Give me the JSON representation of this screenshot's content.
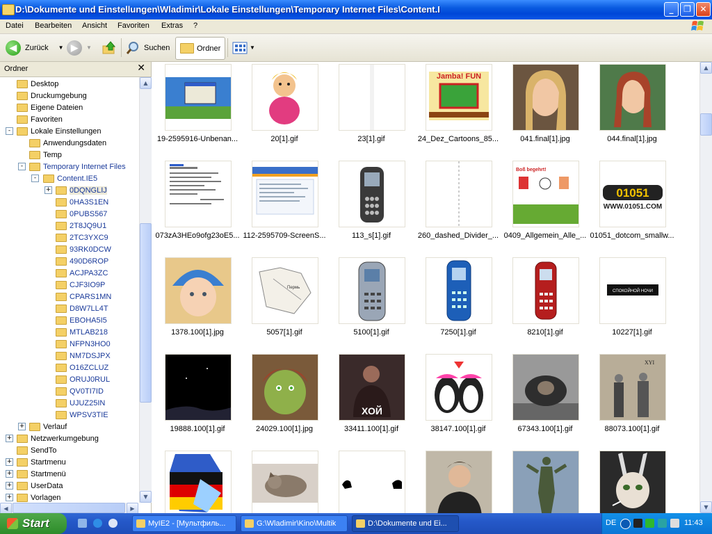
{
  "window": {
    "title": "D:\\Dokumente und Einstellungen\\Wladimir\\Lokale Einstellungen\\Temporary Internet Files\\Content.I",
    "minimize": "_",
    "maximize": "❐",
    "close": "✕"
  },
  "menu": [
    "Datei",
    "Bearbeiten",
    "Ansicht",
    "Favoriten",
    "Extras",
    "?"
  ],
  "toolbar": {
    "back_label": "Zurück",
    "search_label": "Suchen",
    "folders_label": "Ordner"
  },
  "folder_pane": {
    "title": "Ordner",
    "close": "✕",
    "tree": [
      {
        "label": "Desktop",
        "level": 1,
        "exp": ""
      },
      {
        "label": "Druckumgebung",
        "level": 1,
        "exp": ""
      },
      {
        "label": "Eigene Dateien",
        "level": 1,
        "exp": ""
      },
      {
        "label": "Favoriten",
        "level": 1,
        "exp": ""
      },
      {
        "label": "Lokale Einstellungen",
        "level": 1,
        "exp": "-"
      },
      {
        "label": "Anwendungsdaten",
        "level": 2,
        "exp": ""
      },
      {
        "label": "Temp",
        "level": 2,
        "exp": ""
      },
      {
        "label": "Temporary Internet Files",
        "level": 2,
        "exp": "-"
      },
      {
        "label": "Content.IE5",
        "level": 3,
        "exp": "-"
      },
      {
        "label": "0DQNGLIJ",
        "level": 4,
        "exp": "+",
        "selected": true
      },
      {
        "label": "0HA3S1EN",
        "level": 4,
        "exp": ""
      },
      {
        "label": "0PUBS567",
        "level": 4,
        "exp": ""
      },
      {
        "label": "2T8JQ9U1",
        "level": 4,
        "exp": ""
      },
      {
        "label": "2TC3YXC9",
        "level": 4,
        "exp": ""
      },
      {
        "label": "93RK0DCW",
        "level": 4,
        "exp": ""
      },
      {
        "label": "490D6ROP",
        "level": 4,
        "exp": ""
      },
      {
        "label": "ACJPA3ZC",
        "level": 4,
        "exp": ""
      },
      {
        "label": "CJF3IO9P",
        "level": 4,
        "exp": ""
      },
      {
        "label": "CPARS1MN",
        "level": 4,
        "exp": ""
      },
      {
        "label": "D8W7LL4T",
        "level": 4,
        "exp": ""
      },
      {
        "label": "EBOHA5I5",
        "level": 4,
        "exp": ""
      },
      {
        "label": "MTLAB218",
        "level": 4,
        "exp": ""
      },
      {
        "label": "NFPN3HO0",
        "level": 4,
        "exp": ""
      },
      {
        "label": "NM7DSJPX",
        "level": 4,
        "exp": ""
      },
      {
        "label": "O16ZCLUZ",
        "level": 4,
        "exp": ""
      },
      {
        "label": "ORUJ0RUL",
        "level": 4,
        "exp": ""
      },
      {
        "label": "QV0TI7ID",
        "level": 4,
        "exp": ""
      },
      {
        "label": "UJUZ25IN",
        "level": 4,
        "exp": ""
      },
      {
        "label": "WPSV3TIE",
        "level": 4,
        "exp": ""
      },
      {
        "label": "Verlauf",
        "level": 2,
        "exp": "+"
      },
      {
        "label": "Netzwerkumgebung",
        "level": 1,
        "exp": "+"
      },
      {
        "label": "SendTo",
        "level": 1,
        "exp": ""
      },
      {
        "label": "Startmenu",
        "level": 1,
        "exp": "+"
      },
      {
        "label": "Startmenü",
        "level": 1,
        "exp": "+"
      },
      {
        "label": "UserData",
        "level": 1,
        "exp": "+"
      },
      {
        "label": "Vorlagen",
        "level": 1,
        "exp": "+"
      }
    ]
  },
  "files": [
    {
      "name": "19-2595916-Unbenan...",
      "kind": "screen"
    },
    {
      "name": "20[1].gif",
      "kind": "cartoon"
    },
    {
      "name": "23[1].gif",
      "kind": "blank"
    },
    {
      "name": "24_Dez_Cartoons_85...",
      "kind": "fun"
    },
    {
      "name": "041.final[1].jpg",
      "kind": "portrait"
    },
    {
      "name": "044.final[1].jpg",
      "kind": "portrait2"
    },
    {
      "name": "073zA3HEo9ofg23oE5...",
      "kind": "doc"
    },
    {
      "name": "112-2595709-ScreenS...",
      "kind": "screen2"
    },
    {
      "name": "113_s[1].gif",
      "kind": "phone"
    },
    {
      "name": "260_dashed_Divider_...",
      "kind": "dashed"
    },
    {
      "name": "0409_Allgemein_Alle_...",
      "kind": "ebay"
    },
    {
      "name": "01051_dotcom_smallw...",
      "kind": "logo"
    },
    {
      "name": "1378.100[1].jpg",
      "kind": "baby"
    },
    {
      "name": "5057[1].gif",
      "kind": "map"
    },
    {
      "name": "5100[1].gif",
      "kind": "phone2"
    },
    {
      "name": "7250[1].gif",
      "kind": "phone3"
    },
    {
      "name": "8210[1].gif",
      "kind": "phone4"
    },
    {
      "name": "10227[1].gif",
      "kind": "banner"
    },
    {
      "name": "19888.100[1].gif",
      "kind": "dark"
    },
    {
      "name": "24029.100[1].jpg",
      "kind": "shrek"
    },
    {
      "name": "33411.100[1].gif",
      "kind": "khoy"
    },
    {
      "name": "38147.100[1].gif",
      "kind": "penguins"
    },
    {
      "name": "67343.100[1].gif",
      "kind": "monkey"
    },
    {
      "name": "88073.100[1].gif",
      "kind": "old"
    },
    {
      "name": "",
      "kind": "flag"
    },
    {
      "name": "",
      "kind": "cat"
    },
    {
      "name": "",
      "kind": "cats"
    },
    {
      "name": "",
      "kind": "man"
    },
    {
      "name": "",
      "kind": "statue"
    },
    {
      "name": "",
      "kind": "rabbit"
    }
  ],
  "banner_text": "СПОКОЙНОЙ НОЧИ",
  "fun_text": "Jamba! FUN",
  "logo_text": "01051",
  "logo_sub": "WWW.01051.COM",
  "khoy_text": "ХОЙ",
  "ebay_text": "Boß begehrt!",
  "taskbar": {
    "start_label": "Start",
    "tasks": [
      {
        "label": "MyIE2 - [Мультфиль...",
        "active": false
      },
      {
        "label": "G:\\Wladimir\\Kino\\Multik",
        "active": false
      },
      {
        "label": "D:\\Dokumente und Ei...",
        "active": true
      }
    ],
    "lang": "DE",
    "clock": "11:43"
  }
}
